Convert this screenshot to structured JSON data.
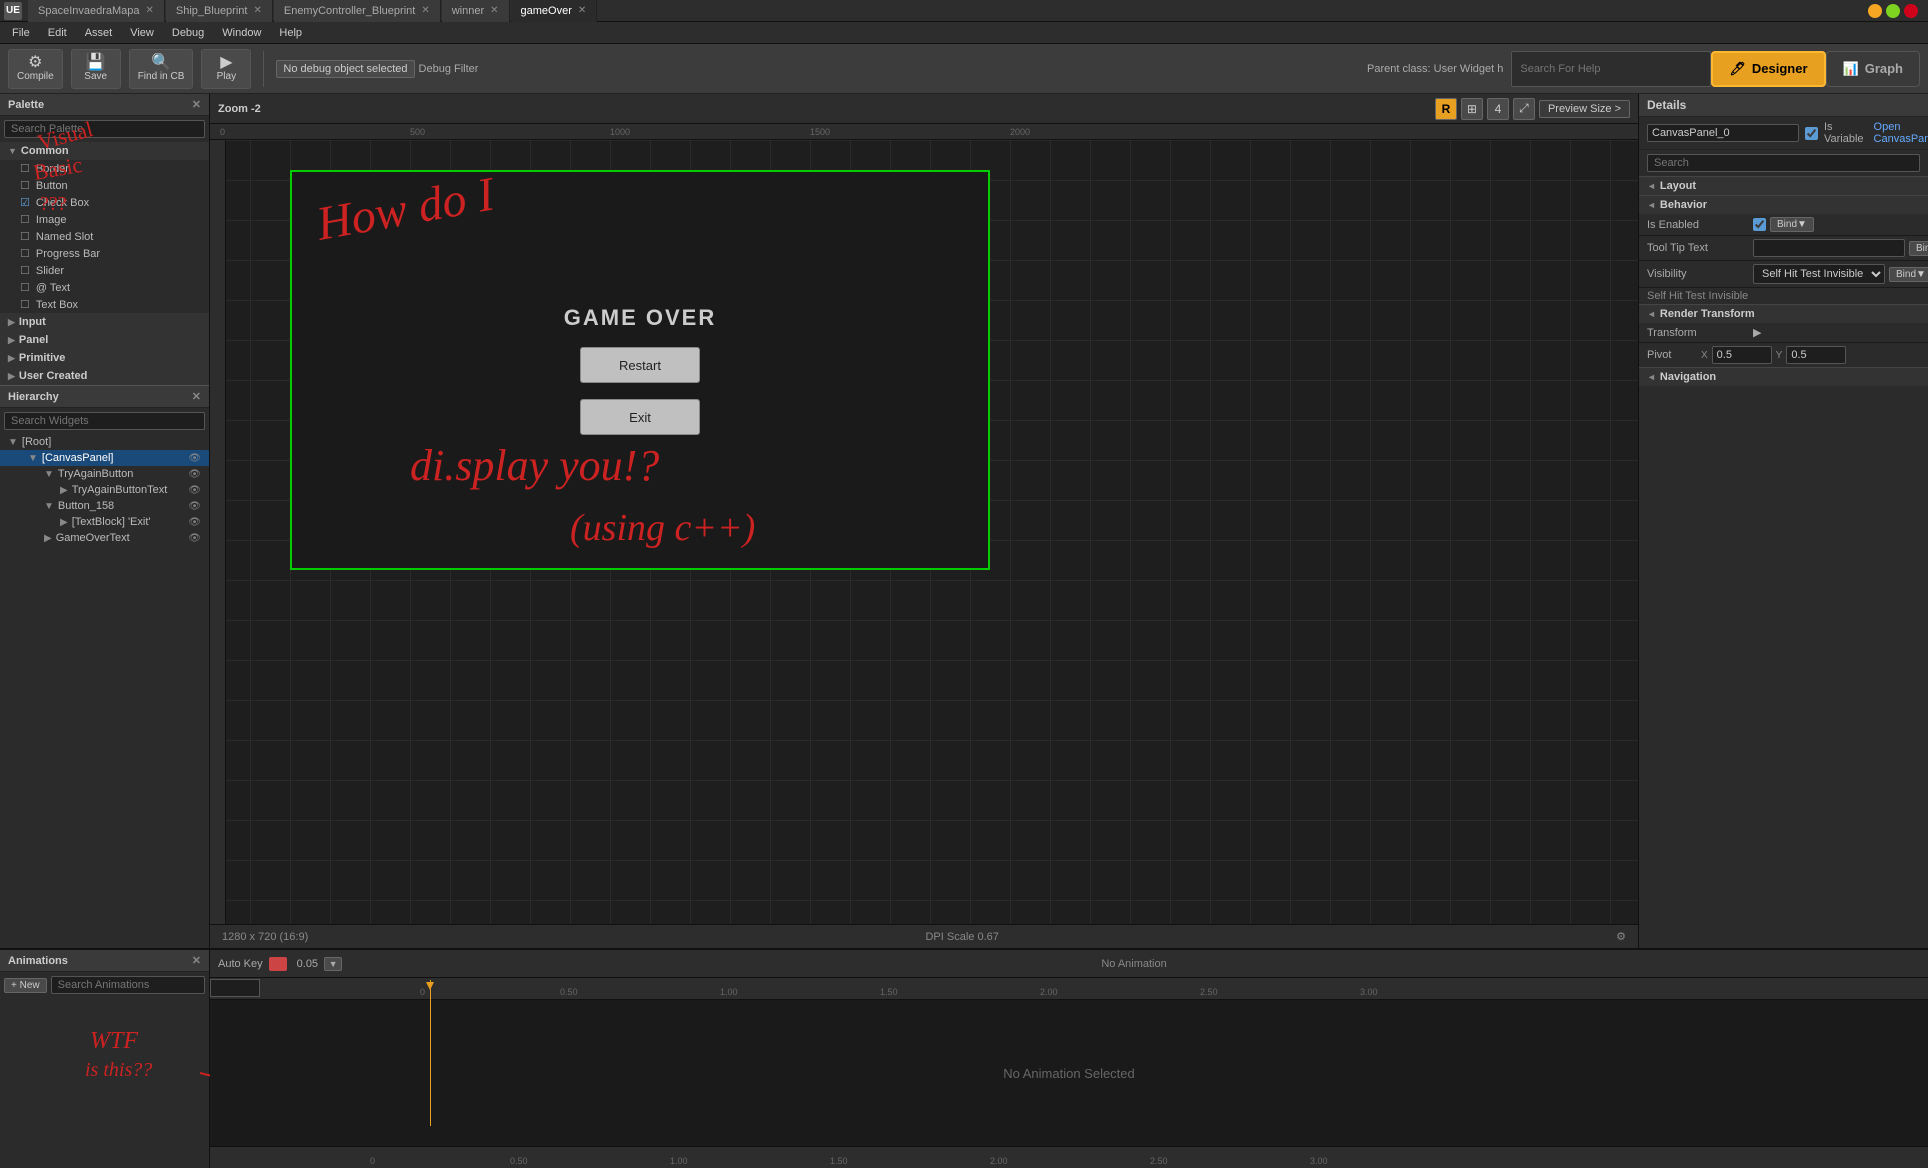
{
  "window": {
    "title": "SpaceInvaedraMapa",
    "tabs": [
      {
        "label": "SpaceInvaedraMapa",
        "active": false
      },
      {
        "label": "Ship_Blueprint",
        "active": false
      },
      {
        "label": "EnemyController_Blueprint",
        "active": false
      },
      {
        "label": "winner",
        "active": false
      },
      {
        "label": "gameOver",
        "active": true
      }
    ]
  },
  "menubar": {
    "items": [
      "File",
      "Edit",
      "Asset",
      "View",
      "Debug",
      "Window",
      "Help"
    ]
  },
  "toolbar": {
    "compile_label": "Compile",
    "save_label": "Save",
    "find_in_cb_label": "Find in CB",
    "play_label": "Play",
    "debug_filter_label": "No debug object selected",
    "designer_label": "Designer",
    "graph_label": "Graph",
    "parent_class": "Parent class: User Widget h",
    "search_help_placeholder": "Search For Help"
  },
  "palette": {
    "title": "Palette",
    "search_placeholder": "Search Palette",
    "sections": {
      "common": {
        "label": "Common",
        "items": [
          {
            "label": "Border",
            "type": "unchecked"
          },
          {
            "label": "Button",
            "type": "unchecked"
          },
          {
            "label": "Check Box",
            "type": "checked"
          },
          {
            "label": "Image",
            "type": "unchecked"
          },
          {
            "label": "Named Slot",
            "type": "unchecked"
          },
          {
            "label": "Progress Bar",
            "type": "unchecked"
          },
          {
            "label": "Slider",
            "type": "unchecked"
          },
          {
            "label": "Text",
            "type": "unchecked"
          },
          {
            "label": "Text Box",
            "type": "unchecked"
          }
        ]
      },
      "input": {
        "label": "Input"
      },
      "panel": {
        "label": "Panel"
      },
      "primitive": {
        "label": "Primitive"
      },
      "user_created": {
        "label": "User Created"
      }
    }
  },
  "hierarchy": {
    "title": "Hierarchy",
    "search_placeholder": "Search Widgets",
    "tree": [
      {
        "label": "[Root]",
        "level": 0,
        "expanded": true
      },
      {
        "label": "[CanvasPanel]",
        "level": 1,
        "expanded": true,
        "selected": true
      },
      {
        "label": "TryAgainButton",
        "level": 2,
        "expanded": true
      },
      {
        "label": "TryAgainButtonText",
        "level": 3,
        "expanded": false
      },
      {
        "label": "Button_158",
        "level": 2,
        "expanded": true
      },
      {
        "label": "[TextBlock] 'Exit'",
        "level": 3,
        "expanded": false
      },
      {
        "label": "GameOverText",
        "level": 2,
        "expanded": false
      }
    ]
  },
  "canvas": {
    "zoom_label": "Zoom -2",
    "preview_size_label": "Preview Size >",
    "resolution_label": "1280 x 720 (16:9)",
    "dpi_label": "DPI Scale 0.67",
    "game_over_title": "GAME OVER",
    "restart_btn": "Restart",
    "exit_btn": "Exit",
    "ruler_marks": [
      "0",
      "500",
      "1000",
      "1500",
      "2000"
    ]
  },
  "details": {
    "title": "Details",
    "canvas_panel_name": "CanvasPanel_0",
    "is_variable_label": "Is Variable",
    "open_canvas_label": "Open CanvasPanel",
    "search_placeholder": "Search",
    "behavior": {
      "section_label": "Behavior",
      "is_enabled_label": "Is Enabled",
      "tooltip_text_label": "Tool Tip Text",
      "visibility_label": "Visibility",
      "visibility_value": "Self Hit Test Invisible",
      "bind_label": "Bind▼"
    },
    "render_transform": {
      "section_label": "Render Transform",
      "transform_label": "Transform",
      "pivot_label": "Pivot",
      "pivot_x": "0.5",
      "pivot_y": "0.5"
    },
    "navigation": {
      "section_label": "Navigation"
    }
  },
  "animations": {
    "title": "Animations",
    "new_btn_label": "+ New",
    "search_placeholder": "Search Animations",
    "auto_key_label": "Auto Key",
    "time_step_label": "0.05",
    "no_animation_label": "No Animation",
    "no_animation_selected": "No Animation Selected",
    "timeline_marks": [
      "0",
      "0.50",
      "1.00",
      "1.50",
      "2.00",
      "2.50",
      "3.00"
    ]
  }
}
